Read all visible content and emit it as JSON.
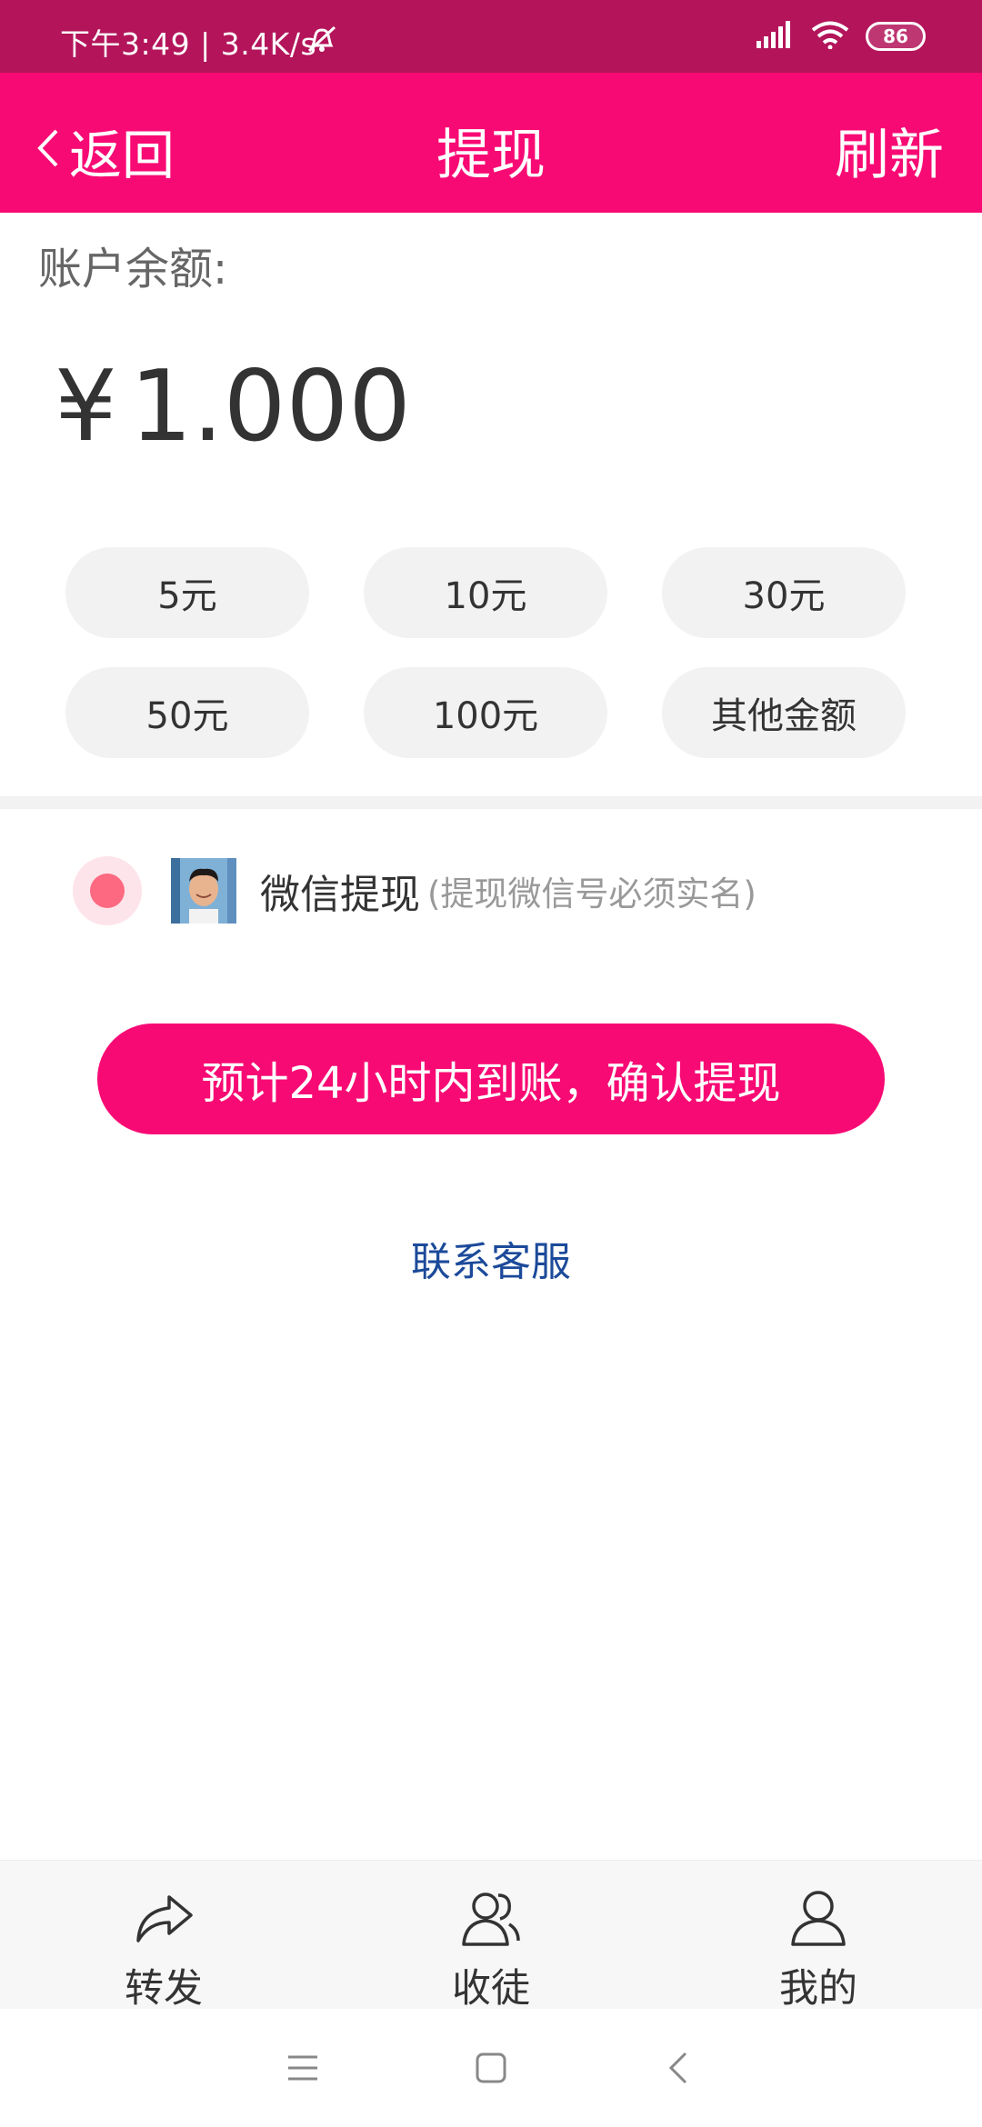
{
  "status": {
    "text": "下午3:49 | 3.4K/s",
    "battery": "86"
  },
  "nav": {
    "back_label": "返回",
    "title": "提现",
    "refresh_label": "刷新"
  },
  "balance": {
    "label": "账户余额:",
    "currency": "¥",
    "amount": "1.000"
  },
  "amount_options": [
    "5元",
    "10元",
    "30元",
    "50元",
    "100元",
    "其他金额"
  ],
  "payment": {
    "label": "微信提现",
    "note": "(提现微信号必须实名)"
  },
  "confirm_label": "预计24小时内到账，确认提现",
  "contact_label": "联系客服",
  "tabs": [
    {
      "label": "转发",
      "icon": "share-icon"
    },
    {
      "label": "收徒",
      "icon": "users-icon"
    },
    {
      "label": "我的",
      "icon": "user-icon"
    }
  ],
  "colors": {
    "brand": "#f80a74",
    "status_bar": "#b3145a",
    "link": "#1c4a9a"
  }
}
